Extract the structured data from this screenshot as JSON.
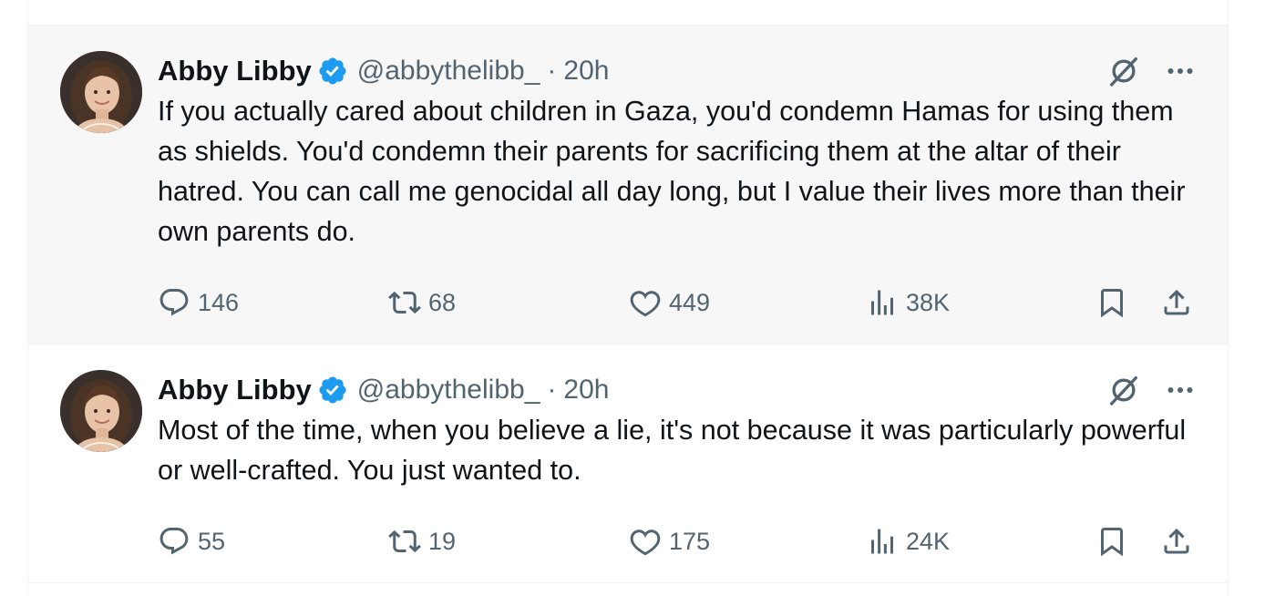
{
  "colors": {
    "text_primary": "#0f1419",
    "text_secondary": "#536471",
    "verified_blue": "#1d9bf0",
    "hover_background": "#f7f7f7",
    "divider": "#eff3f4"
  },
  "icons": {
    "verified": "verified-badge-icon",
    "grok": "grok-icon",
    "more": "more-icon",
    "reply": "reply-icon",
    "retweet": "retweet-icon",
    "like": "heart-icon",
    "views": "views-icon",
    "bookmark": "bookmark-icon",
    "share": "share-icon"
  },
  "tweets": [
    {
      "author_name": "Abby Libby",
      "author_handle": "@abbythelibb_",
      "separator": "·",
      "time": "20h",
      "text": "If you actually cared about children in Gaza, you'd condemn Hamas for using them as shields. You'd condemn their parents for sacrificing them at the altar of their hatred. You can call me genocidal all day long, but I value their lives more than their own parents do.",
      "replies": "146",
      "retweets": "68",
      "likes": "449",
      "views": "38K"
    },
    {
      "author_name": "Abby Libby",
      "author_handle": "@abbythelibb_",
      "separator": "·",
      "time": "20h",
      "text": "Most of the time, when you believe a lie, it's not because it was particularly powerful or well-crafted. You just wanted to.",
      "replies": "55",
      "retweets": "19",
      "likes": "175",
      "views": "24K"
    }
  ]
}
